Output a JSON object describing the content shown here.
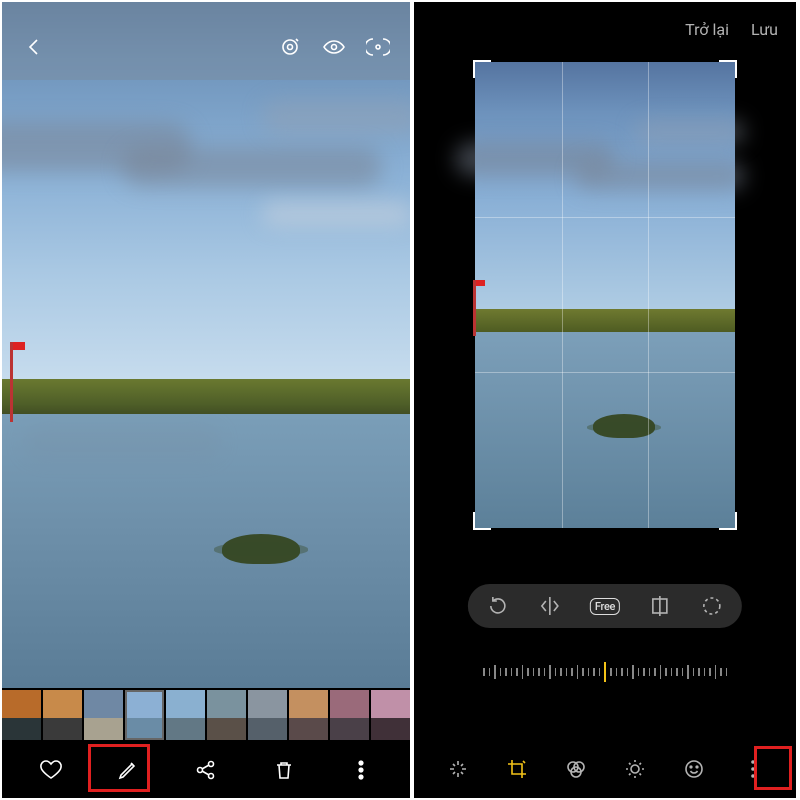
{
  "left": {
    "topbar": {
      "back": "‹"
    },
    "bottombar": {
      "favorite": "Favorite",
      "edit": "Edit",
      "share": "Share",
      "delete": "Delete",
      "more": "More"
    },
    "thumbnails": [
      {
        "color1": "#b86b2a",
        "color2": "#2a3538"
      },
      {
        "color1": "#c88a4a",
        "color2": "#3a3a3a"
      },
      {
        "color1": "#6f88a4",
        "color2": "#a8a290"
      },
      {
        "color1": "#8cb0d4",
        "color2": "#6a8ca6",
        "selected": true
      },
      {
        "color1": "#8ab0d0",
        "color2": "#627885"
      },
      {
        "color1": "#7a929e",
        "color2": "#5a5048"
      },
      {
        "color1": "#8a95a0",
        "color2": "#55606a"
      },
      {
        "color1": "#c49060",
        "color2": "#5a4a4a"
      },
      {
        "color1": "#9a6a7a",
        "color2": "#4a4048"
      },
      {
        "color1": "#c090a8",
        "color2": "#403038"
      }
    ]
  },
  "right": {
    "back": "Trở lại",
    "save": "Lưu",
    "toolpill": {
      "rotate": "Rotate",
      "flip": "Flip",
      "free": "Free",
      "perspective": "Perspective",
      "lasso": "Circle select"
    },
    "editbar": {
      "autoenhance": "Auto",
      "crop": "Crop",
      "filters": "Filters",
      "adjust": "Adjust",
      "stickers": "Stickers",
      "more": "More"
    }
  }
}
